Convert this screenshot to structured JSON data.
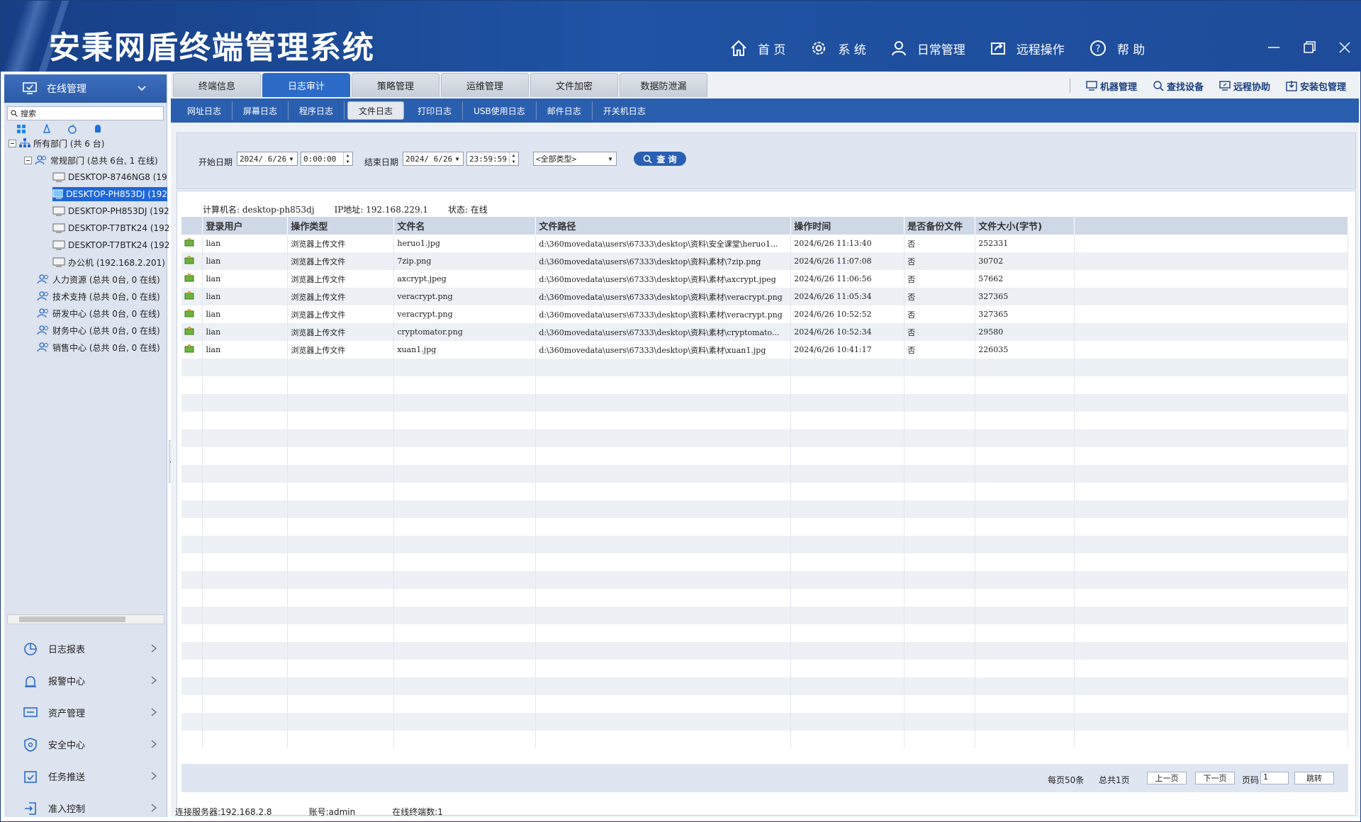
{
  "app": {
    "title": "安秉网盾终端管理系统"
  },
  "topnav": [
    {
      "label": "首 页",
      "icon": "home-icon"
    },
    {
      "label": "系 统",
      "icon": "gear-icon"
    },
    {
      "label": "日常管理",
      "icon": "user-icon"
    },
    {
      "label": "远程操作",
      "icon": "share-icon"
    },
    {
      "label": "帮 助",
      "icon": "help-icon"
    }
  ],
  "sidebar": {
    "header": "在线管理",
    "search_placeholder": "搜索",
    "tree": [
      {
        "label": "所有部门 (共 6 台)"
      },
      {
        "label": "常规部门 (总共 6台, 1 在线)"
      },
      {
        "label": "DESKTOP-8746NG8 (19"
      },
      {
        "label": "DESKTOP-PH853DJ (192"
      },
      {
        "label": "DESKTOP-PH853DJ (192"
      },
      {
        "label": "DESKTOP-T7BTK24 (192"
      },
      {
        "label": "DESKTOP-T7BTK24 (192"
      },
      {
        "label": "办公机 (192.168.2.201)"
      },
      {
        "label": "人力资源 (总共 0台, 0 在线)"
      },
      {
        "label": "技术支持 (总共 0台, 0 在线)"
      },
      {
        "label": "研发中心 (总共 0台, 0 在线)"
      },
      {
        "label": "财务中心 (总共 0台, 0 在线)"
      },
      {
        "label": "销售中心 (总共 0台, 0 在线)"
      }
    ],
    "menu": [
      {
        "label": "日志报表"
      },
      {
        "label": "报警中心"
      },
      {
        "label": "资产管理"
      },
      {
        "label": "安全中心"
      },
      {
        "label": "任务推送"
      },
      {
        "label": "准入控制"
      }
    ]
  },
  "tabs": [
    "终端信息",
    "日志审计",
    "策略管理",
    "运维管理",
    "文件加密",
    "数据防泄漏"
  ],
  "tools": [
    "机器管理",
    "查找设备",
    "远程协助",
    "安装包管理"
  ],
  "subtabs": [
    "网址日志",
    "屏幕日志",
    "程序日志",
    "文件日志",
    "打印日志",
    "USB使用日志",
    "邮件日志",
    "开关机日志"
  ],
  "filter": {
    "start_label": "开始日期",
    "start_date": "2024/ 6/26",
    "start_time": "0:00:00",
    "end_label": "结束日期",
    "end_date": "2024/ 6/26",
    "end_time": "23:59:59",
    "type": "<全部类型>",
    "query": "查 询"
  },
  "info": {
    "computer": "计算机名: desktop-ph853dj",
    "ip": "IP地址: 192.168.229.1",
    "state": "状态: 在线"
  },
  "table": {
    "headers": [
      "",
      "登录用户",
      "操作类型",
      "文件名",
      "文件路径",
      "操作时间",
      "是否备份文件",
      "文件大小(字节)",
      ""
    ],
    "rows": [
      [
        "lian",
        "浏览器上传文件",
        "heruo1.jpg",
        "d:\\360movedata\\users\\67333\\desktop\\资料\\安全课堂\\heruo1...",
        "2024/6/26 11:13:40",
        "否",
        "252331"
      ],
      [
        "lian",
        "浏览器上传文件",
        "7zip.png",
        "d:\\360movedata\\users\\67333\\desktop\\资料\\素材\\7zip.png",
        "2024/6/26 11:07:08",
        "否",
        "30702"
      ],
      [
        "lian",
        "浏览器上传文件",
        "axcrypt.jpeg",
        "d:\\360movedata\\users\\67333\\desktop\\资料\\素材\\axcrypt.jpeg",
        "2024/6/26 11:06:56",
        "否",
        "57662"
      ],
      [
        "lian",
        "浏览器上传文件",
        "veracrypt.png",
        "d:\\360movedata\\users\\67333\\desktop\\资料\\素材\\veracrypt.png",
        "2024/6/26 11:05:34",
        "否",
        "327365"
      ],
      [
        "lian",
        "浏览器上传文件",
        "veracrypt.png",
        "d:\\360movedata\\users\\67333\\desktop\\资料\\素材\\veracrypt.png",
        "2024/6/26 10:52:52",
        "否",
        "327365"
      ],
      [
        "lian",
        "浏览器上传文件",
        "cryptomator.png",
        "d:\\360movedata\\users\\67333\\desktop\\资料\\素材\\cryptomato...",
        "2024/6/26 10:52:34",
        "否",
        "29580"
      ],
      [
        "lian",
        "浏览器上传文件",
        "xuan1.jpg",
        "d:\\360movedata\\users\\67333\\desktop\\资料\\素材\\xuan1.jpg",
        "2024/6/26 10:41:17",
        "否",
        "226035"
      ]
    ]
  },
  "pager": {
    "per_page": "每页50条",
    "total": "总共1页",
    "prev": "上一页",
    "next": "下一页",
    "page_label": "页码",
    "page_value": "1",
    "jump": "跳转"
  },
  "status": {
    "server": "连接服务器:192.168.2.8",
    "account": "账号:admin",
    "online": "在线终端数:1"
  }
}
